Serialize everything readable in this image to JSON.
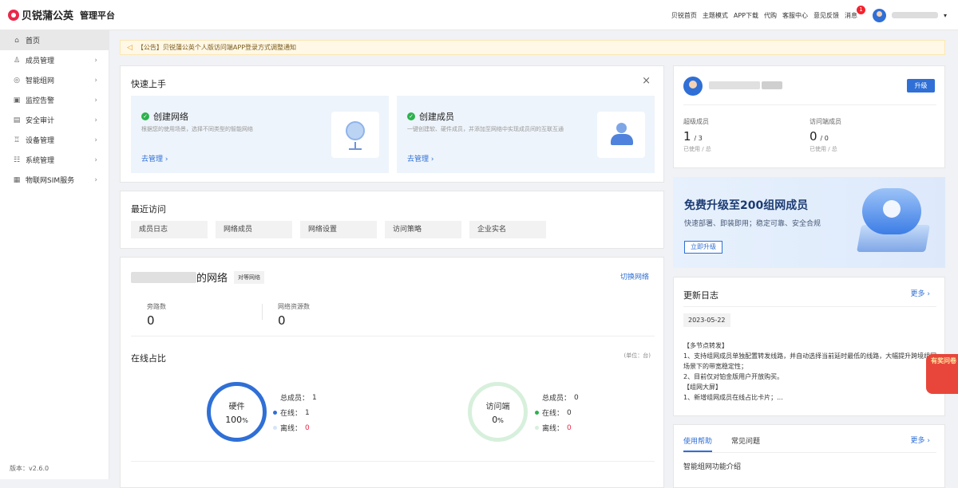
{
  "app": {
    "logo_text": "贝锐蒲公英",
    "platform": "管理平台",
    "version": "版本：v2.6.0"
  },
  "topnav": {
    "items": [
      "贝锐首页",
      "主题模式",
      "APP下载",
      "代购",
      "客服中心",
      "意见反馈"
    ],
    "messages": "消息",
    "message_count": "1"
  },
  "sidebar": {
    "items": [
      {
        "label": "首页",
        "icon": "home-icon",
        "glyph": "⌂",
        "active": true,
        "arrow": false
      },
      {
        "label": "成员管理",
        "icon": "user-icon",
        "glyph": "♙",
        "active": false,
        "arrow": true
      },
      {
        "label": "智能组网",
        "icon": "network-icon",
        "glyph": "◎",
        "active": false,
        "arrow": true
      },
      {
        "label": "监控告警",
        "icon": "monitor-icon",
        "glyph": "▣",
        "active": false,
        "arrow": true
      },
      {
        "label": "安全审计",
        "icon": "audit-icon",
        "glyph": "▤",
        "active": false,
        "arrow": true
      },
      {
        "label": "设备管理",
        "icon": "device-icon",
        "glyph": "♖",
        "active": false,
        "arrow": true
      },
      {
        "label": "系统管理",
        "icon": "system-icon",
        "glyph": "☷",
        "active": false,
        "arrow": true
      },
      {
        "label": "物联网SIM服务",
        "icon": "sim-icon",
        "glyph": "▦",
        "active": false,
        "arrow": true
      }
    ],
    "arrow_glyph": "›"
  },
  "notice": {
    "text": "【公告】贝锐蒲公英个人版访问端APP登录方式调整通知"
  },
  "quickstart": {
    "title": "快速上手",
    "close": "×",
    "items": [
      {
        "title": "创建网络",
        "desc": "根据您的使用场景，选择不同类型的智能网络",
        "link": "去管理 ›"
      },
      {
        "title": "创建成员",
        "desc": "一键创建软、硬件成员，并添加至网络中实现成员间的互联互通",
        "link": "去管理 ›"
      }
    ]
  },
  "recent": {
    "title": "最近访问",
    "chips": [
      "成员日志",
      "网络成员",
      "网络设置",
      "访问策略",
      "企业实名"
    ]
  },
  "network": {
    "title_suffix": "的网络",
    "tag": "对等网络",
    "switch": "切换网络",
    "stats": [
      {
        "label": "旁路数",
        "value": "0"
      },
      {
        "label": "网络资源数",
        "value": "0"
      }
    ],
    "online_title": "在线占比",
    "unit": "(单位：台)",
    "rings": [
      {
        "title": "硬件",
        "pct": "100",
        "pct_unit": "%",
        "total_label": "总成员：",
        "total": "1",
        "online_label": "在线：",
        "online": "1",
        "offline_label": "离线：",
        "offline": "0"
      },
      {
        "title": "访问端",
        "pct": "0",
        "pct_unit": "%",
        "total_label": "总成员：",
        "total": "0",
        "online_label": "在线：",
        "online": "0",
        "offline_label": "离线：",
        "offline": "0"
      }
    ]
  },
  "account": {
    "upgrade": "升级",
    "super_label": "超级成员",
    "super_used": "1",
    "super_total": "/ 3",
    "super_sub": "已使用 / 总",
    "visit_label": "访问端成员",
    "visit_used": "0",
    "visit_total": "/ 0",
    "visit_sub": "已使用 / 总"
  },
  "promo": {
    "title": "免费升级至200组网成员",
    "subtitle": "快速部署、即装即用；稳定可靠、安全合规",
    "button": "立即升级"
  },
  "changelog": {
    "title": "更新日志",
    "more": "更多 ›",
    "date": "2023-05-22",
    "lines": [
      "【多节点转发】",
      "1、支持组网成员单独配置转发线路，并自动选择当前延时最低的线路，大幅提升跨境组网场景下的带宽稳定性；",
      "2、目前仅对铂金版用户开放购买。",
      "【组网大屏】",
      "1、新增组网成员在线占比卡片；..."
    ]
  },
  "help": {
    "tabs": [
      "使用帮助",
      "常见问题"
    ],
    "more": "更多 ›",
    "first": "智能组网功能介绍"
  },
  "envelope": {
    "text": "有奖问卷"
  },
  "colors": {
    "brand": "#e8294a",
    "primary": "#2f6fd6",
    "success": "#2bb24c"
  }
}
